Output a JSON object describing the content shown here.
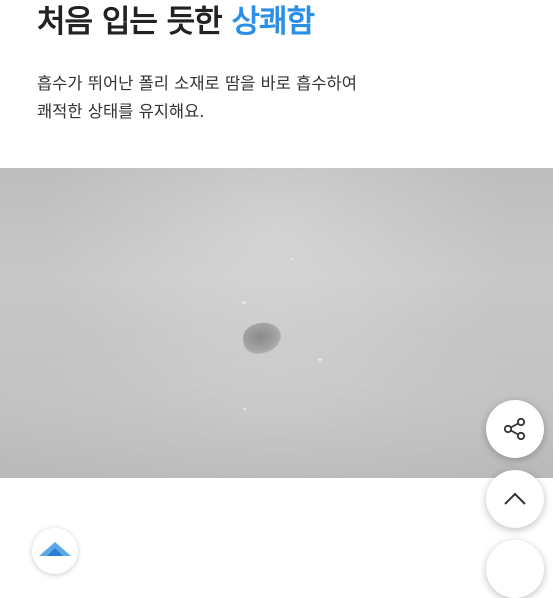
{
  "headline": {
    "prefix": "처음 입는 듯한",
    "accent": "상쾌함"
  },
  "description": {
    "line1": "흡수가 뛰어난 폴리 소재로 땀을 바로 흡수하여",
    "line2": "쾌적한 상태를 유지해요."
  },
  "buttons": {
    "share_icon": "share-icon",
    "scroll_top_icon": "chevron-up-icon"
  },
  "colors": {
    "accent": "#2b8fe6",
    "text": "#222222"
  }
}
